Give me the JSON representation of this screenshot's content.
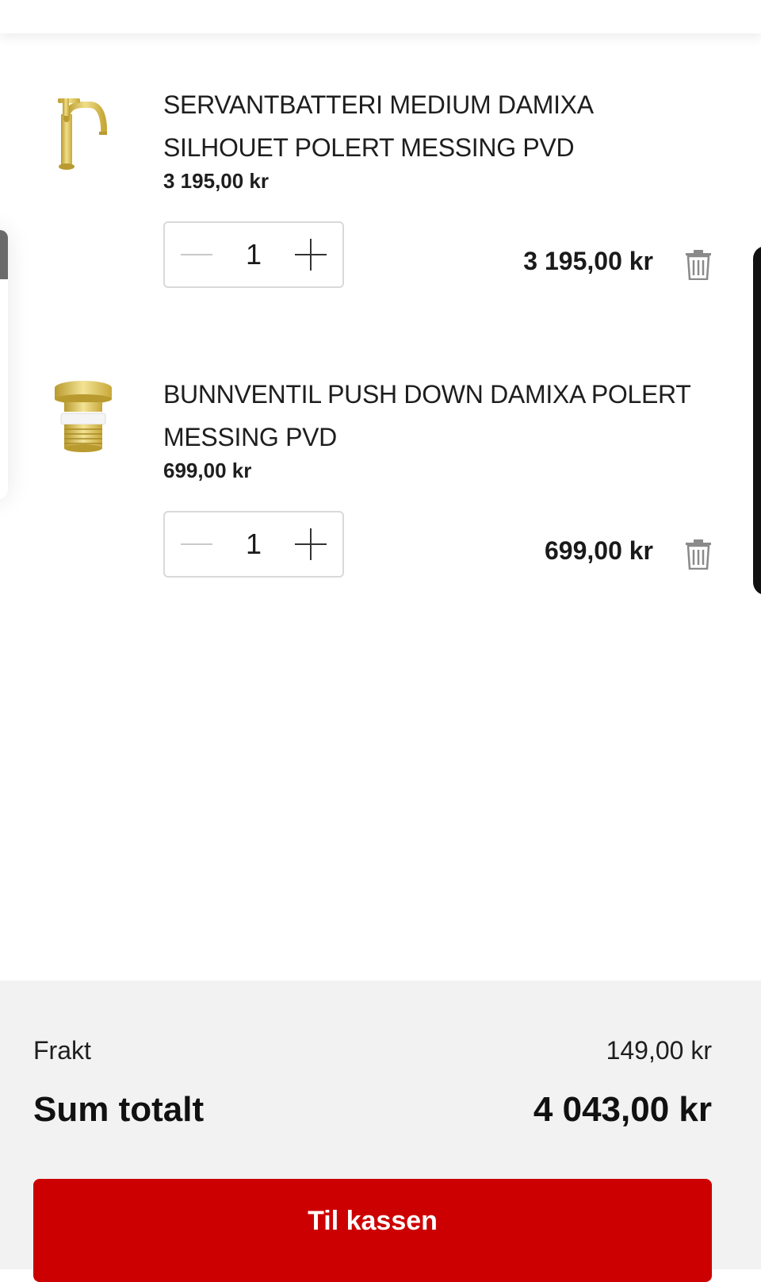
{
  "cart": {
    "items": [
      {
        "title": "SERVANTBATTERI MEDIUM DAMIXA SILHOUET POLERT MESSING PVD",
        "unit_price": "3 195,00 kr",
        "quantity": "1",
        "line_total": "3 195,00 kr",
        "image_icon": "gold-faucet-image"
      },
      {
        "title": "BUNNVENTIL PUSH DOWN DAMIXA POLERT MESSING PVD",
        "unit_price": "699,00 kr",
        "quantity": "1",
        "line_total": "699,00 kr",
        "image_icon": "gold-drain-valve-image"
      }
    ]
  },
  "summary": {
    "shipping_label": "Frakt",
    "shipping_value": "149,00 kr",
    "total_label": "Sum totalt",
    "total_value": "4 043,00 kr",
    "checkout_label": "Til kassen"
  },
  "colors": {
    "accent": "#cc0000",
    "summary_bg": "#f2f2f2",
    "product_gold": "#d9bf52"
  },
  "icons": {
    "minus": "minus-icon",
    "plus": "plus-icon",
    "delete": "trash-icon"
  }
}
